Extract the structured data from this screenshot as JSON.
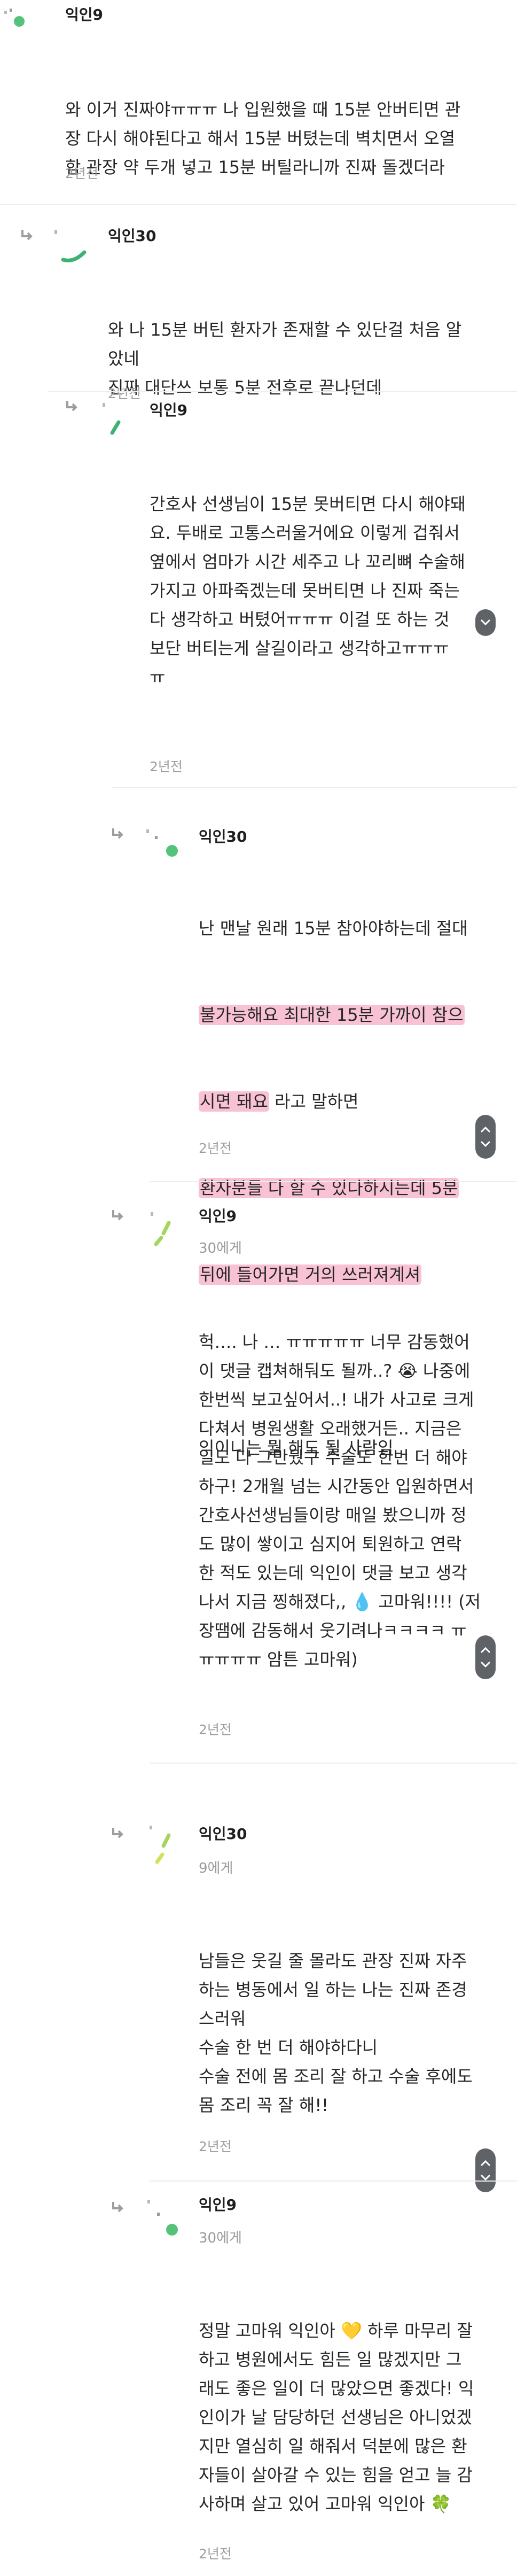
{
  "comments": [
    {
      "author": "익인9",
      "lines": [
        "와 이거 진짜야ㅠㅠㅠ 나 입원했을 때 15분 안버티면 관",
        "장 다시 해야된다고 해서 15분 버텼는데 벽치면서 오열",
        "함 관장 약 두개 넣고 15분 버틸라니까 진짜 돌겠더라"
      ],
      "time": "2년전"
    },
    {
      "author": "익인30",
      "lines": [
        "와 나 15분 버틴 환자가 존재할 수 있단걸 처음 알",
        "았네",
        "진짜 대단쓰 보통 5분 전후로 끝나던데"
      ],
      "time": "2년전"
    },
    {
      "author": "익인9",
      "lines": [
        "간호사 선생님이 15분 못버티면 다시 해야돼",
        "요. 두배로 고통스러울거에요 이렇게 겁줘서",
        "옆에서 엄마가 시간 세주고 나 꼬리뼈 수술해",
        "가지고 아파죽겠는데 못버티면 나 진짜 죽는",
        "다 생각하고 버텼어ㅠㅠㅠ 이걸 또 하는 것",
        "보단 버티는게 살길이라고 생각하고ㅠㅠㅠ",
        "ㅠ"
      ],
      "time": "2년전"
    },
    {
      "author": "익인30",
      "line1": "난 맨날 원래 15분 참아야하는데 절대",
      "hl1": "불가능해요 최대한 15분 가까이 참으",
      "hl2": "시면 돼요",
      "line3_rest": " 라고 말하면",
      "hl3": "환자분들 다 할 수 있다하시는데 5분",
      "hl4": "뒤에 들어가면 거의 쓰러져계셔",
      "line7": "익이니는 뭘 해도 될 사람임",
      "time": "2년전"
    },
    {
      "author": "익인9",
      "mention": "30에게",
      "lines": [
        "헉…. 나 … ㅠㅠㅠㅠㅠ 너무 감동했어",
        "이 댓글 캡쳐해둬도 될까..? 😭 나중에",
        "한번씩 보고싶어서..! 내가 사고로 크게",
        "다쳐서 병원생활 오래했거든.. 지금은",
        "일도 다 그만뒀구 수술도 한번 더 해야",
        "하구! 2개월 넘는 시간동안 입원하면서",
        "간호사선생님들이랑 매일 봤으니까 정",
        "도 많이 쌓이고 심지어 퇴원하고 연락",
        "한 적도 있는데 익인이 댓글 보고 생각",
        "나서 지금 찡해졌다,, 💧 고마워!!!! (저",
        "장땜에 감동해서 웃기려나ㅋㅋㅋㅋ ㅠ",
        "ㅠㅠㅠㅠ 암튼 고마워)"
      ],
      "time": "2년전"
    },
    {
      "author": "익인30",
      "mention": "9에게",
      "lines": [
        "남들은 웃길 줄 몰라도 관장 진짜 자주",
        "하는 병동에서 일 하는 나는 진짜 존경",
        "스러워",
        "수술 한 번 더 해야하다니",
        "수술 전에 몸 조리 잘 하고 수술 후에도",
        "몸 조리 꼭 잘 해!!"
      ],
      "time": "2년전"
    },
    {
      "author": "익인9",
      "mention": "30에게",
      "lines": [
        "정말 고마워 익인아 💛 하루 마무리 잘",
        "하고 병원에서도 힘든 일 많겠지만 그",
        "래도 좋은 일이 더 많았으면 좋겠다! 익",
        "인이가 날 담당하던 선생님은 아니었겠",
        "지만 열심히 일 해줘서 덕분에 많은 환",
        "자들이 살아갈 수 있는 힘을 얻고 늘 감",
        "사하며 살고 있어 고마워 익인아 🍀"
      ],
      "time": "2년전"
    }
  ],
  "colors": {
    "accent_green": "#3cb371",
    "avatar_green": "#55c27a",
    "highlight_pink": "#f48fb1",
    "icon_grey": "#9e9e9e",
    "scroll_button": "#5f6368"
  },
  "icons": {
    "reply": "reply-arrow-icon",
    "avatar": "random-dot-avatar-icon",
    "scroll_up": "chevron-up-icon",
    "scroll_down": "chevron-down-icon"
  }
}
